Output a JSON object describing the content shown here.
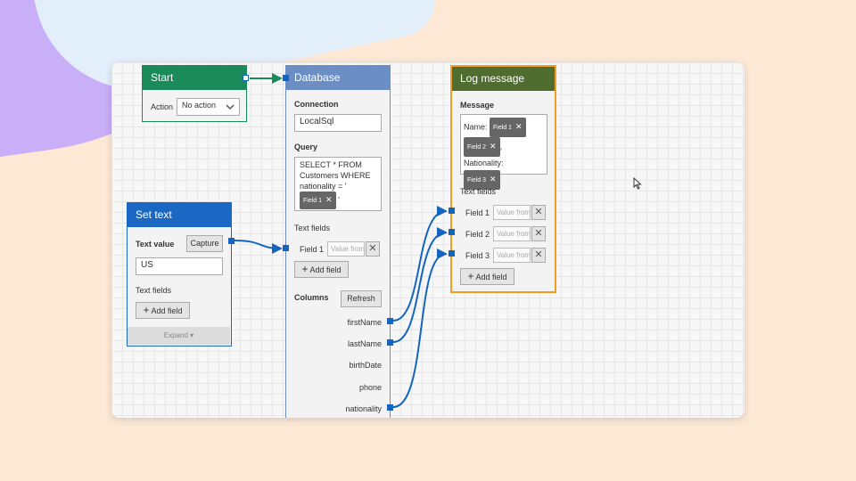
{
  "colors": {
    "start_header": "#1b8a5a",
    "database_header": "#6b8ec4",
    "settext_header": "#1a68c4",
    "log_header": "#4f6d2f",
    "log_border": "#f0a020",
    "wire": "#1565c0"
  },
  "start": {
    "title": "Start",
    "action_label": "Action",
    "action_value": "No action"
  },
  "database": {
    "title": "Database",
    "connection_label": "Connection",
    "connection_value": "LocalSql",
    "query_label": "Query",
    "query_lines": [
      "SELECT * FROM",
      "Customers WHERE",
      "nationality = '"
    ],
    "query_chip": "Field 1",
    "query_tail": "'",
    "text_fields_label": "Text fields",
    "field1_label": "Field 1",
    "value_placeholder": "Value from",
    "add_field": "Add field",
    "columns_label": "Columns",
    "refresh": "Refresh",
    "columns": [
      "firstName",
      "lastName",
      "birthDate",
      "phone",
      "nationality"
    ]
  },
  "settext": {
    "title": "Set text",
    "text_value_label": "Text value",
    "capture": "Capture",
    "value": "US",
    "text_fields_label": "Text fields",
    "add_field": "Add field",
    "expand": "Expand"
  },
  "log": {
    "title": "Log message",
    "message_label": "Message",
    "name_text": "Name:",
    "chip1": "Field 1",
    "chip2": "Field 2",
    "comma": ",",
    "nationality_text": "Nationality:",
    "chip3": "Field 3",
    "text_fields_label": "Text fields",
    "fields": [
      "Field 1",
      "Field 2",
      "Field 3"
    ],
    "value_placeholder": "Value from",
    "add_field": "Add field"
  },
  "icons": {
    "plus": "plus-icon",
    "close": "close-icon",
    "chevron": "chevron-down-icon",
    "cursor": "mouse-cursor-icon"
  }
}
